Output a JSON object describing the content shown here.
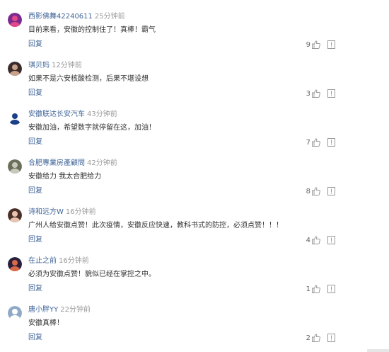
{
  "comments": [
    {
      "username": "西影佛舞42240611",
      "time": "25分钟前",
      "text": "目前来看，安徽的控制住了！真棒！霸气",
      "reply": "回复",
      "likes": "9",
      "avatar_colors": [
        "#7b2a8f",
        "#e0488a"
      ]
    },
    {
      "username": "琪贝妈",
      "time": "12分钟前",
      "text": "如果不是六安核酸检测，后果不堪设想",
      "reply": "回复",
      "likes": "3",
      "avatar_colors": [
        "#3a2b2b",
        "#c9a08a"
      ]
    },
    {
      "username": "安徽联达长安汽车",
      "time": "43分钟前",
      "text": "安徽加油，希望数字就停留在这，加油！",
      "reply": "回复",
      "likes": "7",
      "avatar_colors": [
        "#ffffff",
        "#1d3f8a"
      ]
    },
    {
      "username": "合肥專業房產顧問",
      "time": "42分钟前",
      "text": "安徽给力 我太合肥给力",
      "reply": "回复",
      "likes": "8",
      "avatar_colors": [
        "#6a6f5a",
        "#c7c9bd"
      ]
    },
    {
      "username": "诗和远方W",
      "time": "16分钟前",
      "text": "广州人给安徽点赞！此次疫情，安徽反应快速，教科书式的防控，必须点赞！！！",
      "reply": "回复",
      "likes": "4",
      "avatar_colors": [
        "#4a2f26",
        "#e8c4b0"
      ]
    },
    {
      "username": "在止之前",
      "time": "16分钟前",
      "text": "必须为安徽点赞！貌似已经在掌控之中。",
      "reply": "回复",
      "likes": "1",
      "avatar_colors": [
        "#2a1f3a",
        "#d86a4a"
      ]
    },
    {
      "username": "唐小胖YY",
      "time": "22分钟前",
      "text": "安徽真棒！",
      "reply": "回复",
      "likes": "2",
      "avatar_colors": [
        "#8fa9c7",
        "#ffffff"
      ]
    }
  ],
  "colors": {
    "username": "#406599",
    "time": "#999999",
    "text": "#333333",
    "icon": "#999999"
  }
}
